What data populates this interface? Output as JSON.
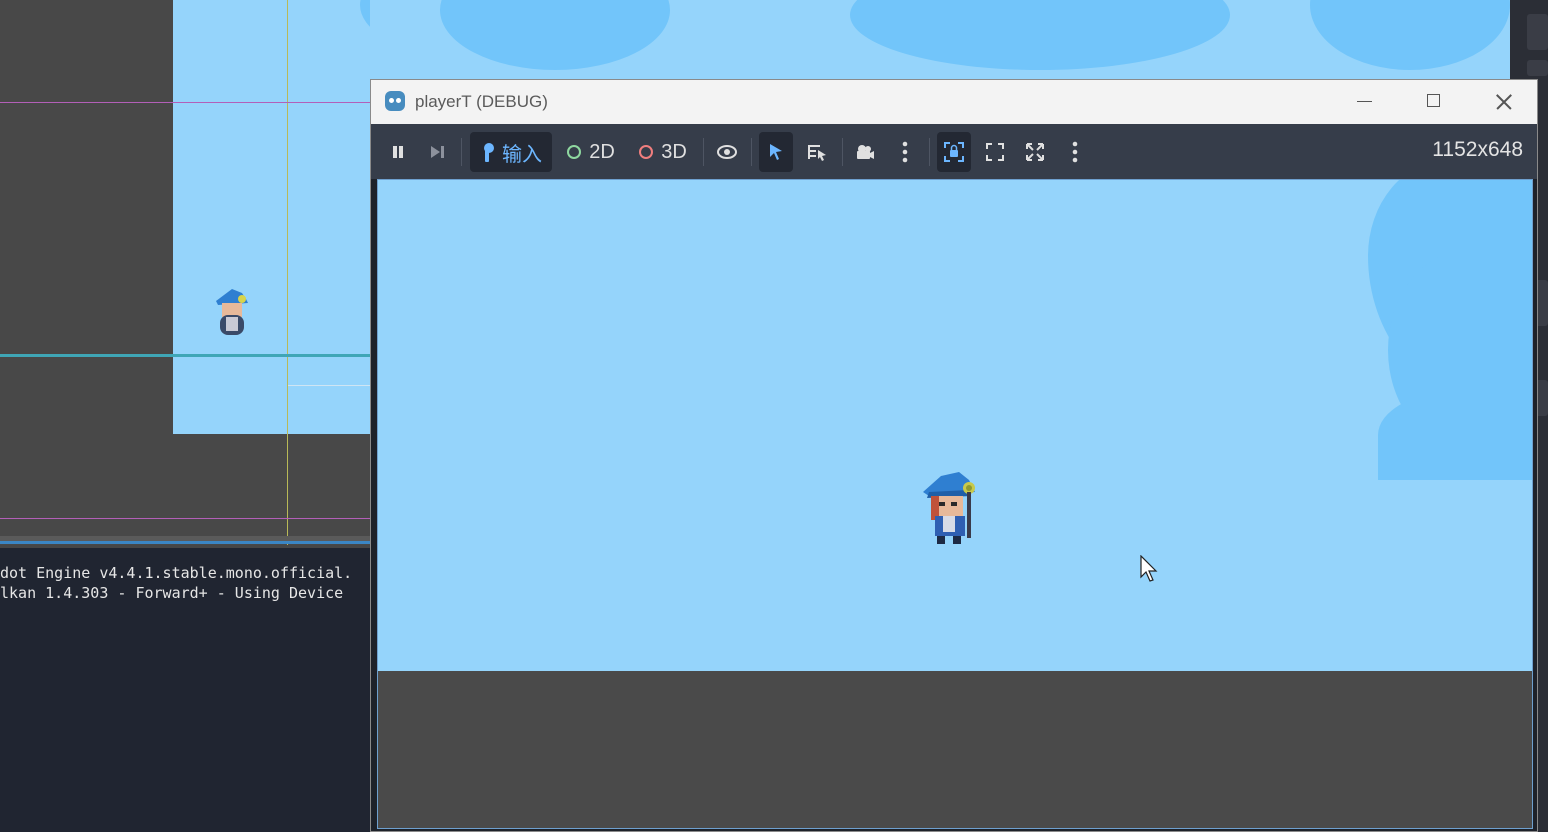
{
  "window": {
    "title": "playerT (DEBUG)"
  },
  "toolbar": {
    "input_label": "输入",
    "btn_2d": "2D",
    "btn_3d": "3D",
    "resolution": "1152x648"
  },
  "console": {
    "lines": [
      "dot Engine v4.4.1.stable.mono.official.",
      "lkan 1.4.303 - Forward+ - Using Device"
    ]
  },
  "colors": {
    "sky": "#95d4fb",
    "cloud": "#72c5fa",
    "editor_bg": "#484848",
    "console_bg": "#202531",
    "toolbar_bg": "#363d4a",
    "accent_blue": "#6cb6ff",
    "dot_2d": "#8fd8a0",
    "dot_3d": "#f07e7e"
  },
  "icons": {
    "pause": "pause-icon",
    "next_frame": "next-frame-icon",
    "input": "joystick-icon",
    "visibility": "eye-icon",
    "select": "arrow-select-icon",
    "list_select": "list-select-icon",
    "camera": "camera-icon",
    "more1": "more-icon",
    "focus": "focus-frame-icon",
    "fullscreen": "fullscreen-icon",
    "fullscreen2": "expand-icon",
    "more2": "more-icon"
  }
}
